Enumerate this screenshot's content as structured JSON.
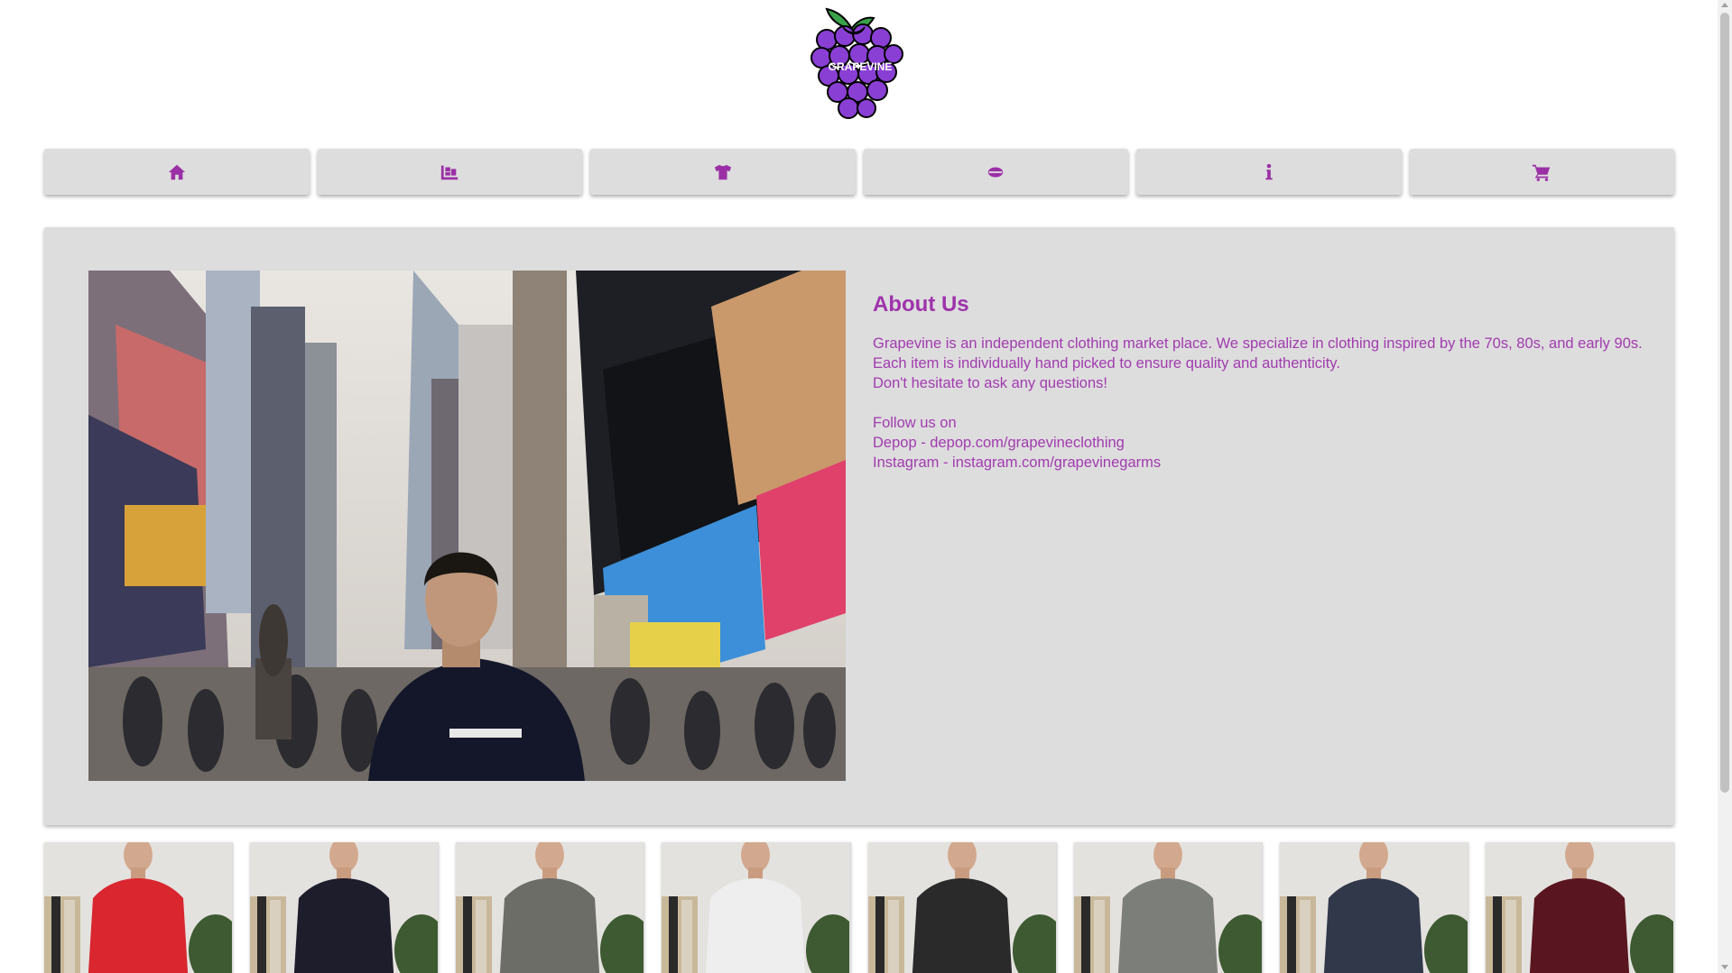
{
  "brand": {
    "name": "GRAPEVINE"
  },
  "nav": {
    "items": [
      {
        "icon": "home-icon"
      },
      {
        "icon": "dolly-icon"
      },
      {
        "icon": "tshirt-icon"
      },
      {
        "icon": "hat-icon"
      },
      {
        "icon": "info-icon"
      },
      {
        "icon": "cart-icon"
      }
    ]
  },
  "about": {
    "title": "About Us",
    "lines": [
      "Grapevine is an independent clothing market place. We specialize in clothing inspired by the 70s, 80s, and early 90s.",
      "Each item is individually hand picked to ensure quality and authenticity.",
      "Don't hesitate to ask any questions!"
    ],
    "follow_label": "Follow us on",
    "depop": "Depop - depop.com/grapevineclothing",
    "instagram": "Instagram - instagram.com/grapevinegarms"
  },
  "products": [
    {
      "shirt_color": "#d9262f"
    },
    {
      "shirt_color": "#1e1d2c"
    },
    {
      "shirt_color": "#6b6d66"
    },
    {
      "shirt_color": "#eeeeee"
    },
    {
      "shirt_color": "#2a2a2a"
    },
    {
      "shirt_color": "#7c7e7a"
    },
    {
      "shirt_color": "#30384a"
    },
    {
      "shirt_color": "#5a1620"
    }
  ],
  "colors": {
    "accent": "#9e33ab",
    "panel": "#dddddd"
  }
}
